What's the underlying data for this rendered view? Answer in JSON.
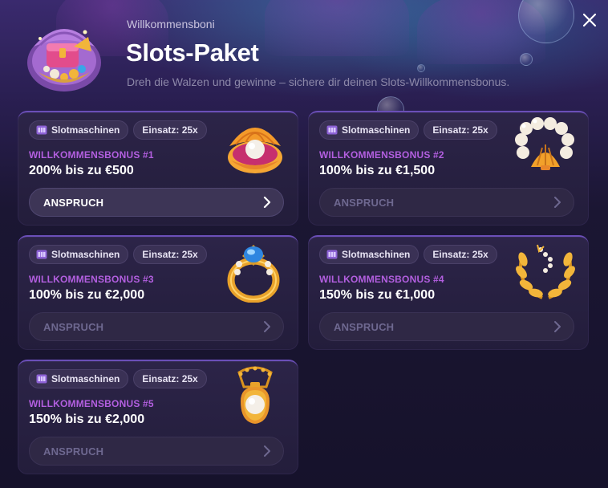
{
  "header": {
    "eyebrow": "Willkommensboni",
    "title": "Slots-Paket",
    "subtitle": "Dreh die Walzen und gewinne – sichere dir deinen Slots-Willkommensbonus.",
    "icon": "treasure-chest-icon"
  },
  "close_icon": "close-icon",
  "cards": [
    {
      "tag_game": "Slotmaschinen",
      "tag_wager": "Einsatz: 25x",
      "label": "WILLKOMMENSBONUS #1",
      "value": "200% bis zu €500",
      "button": "ANSPRUCH",
      "active": true,
      "art": "pearl-shell"
    },
    {
      "tag_game": "Slotmaschinen",
      "tag_wager": "Einsatz: 25x",
      "label": "WILLKOMMENSBONUS #2",
      "value": "100% bis zu €1,500",
      "button": "ANSPRUCH",
      "active": false,
      "art": "pearl-bracelet"
    },
    {
      "tag_game": "Slotmaschinen",
      "tag_wager": "Einsatz: 25x",
      "label": "WILLKOMMENSBONUS #3",
      "value": "100% bis zu €2,000",
      "button": "ANSPRUCH",
      "active": false,
      "art": "sapphire-ring"
    },
    {
      "tag_game": "Slotmaschinen",
      "tag_wager": "Einsatz: 25x",
      "label": "WILLKOMMENSBONUS #4",
      "value": "150% bis zu €1,000",
      "button": "ANSPRUCH",
      "active": false,
      "art": "laurel-wreath"
    },
    {
      "tag_game": "Slotmaschinen",
      "tag_wager": "Einsatz: 25x",
      "label": "WILLKOMMENSBONUS #5",
      "value": "150% bis zu €2,000",
      "button": "ANSPRUCH",
      "active": false,
      "art": "pearl-amulet"
    }
  ],
  "colors": {
    "accent_label": "#b35fe0",
    "card_bg": "#2c2448",
    "card_border_top": "#6b4fb8",
    "gold": "#f2b53a"
  }
}
